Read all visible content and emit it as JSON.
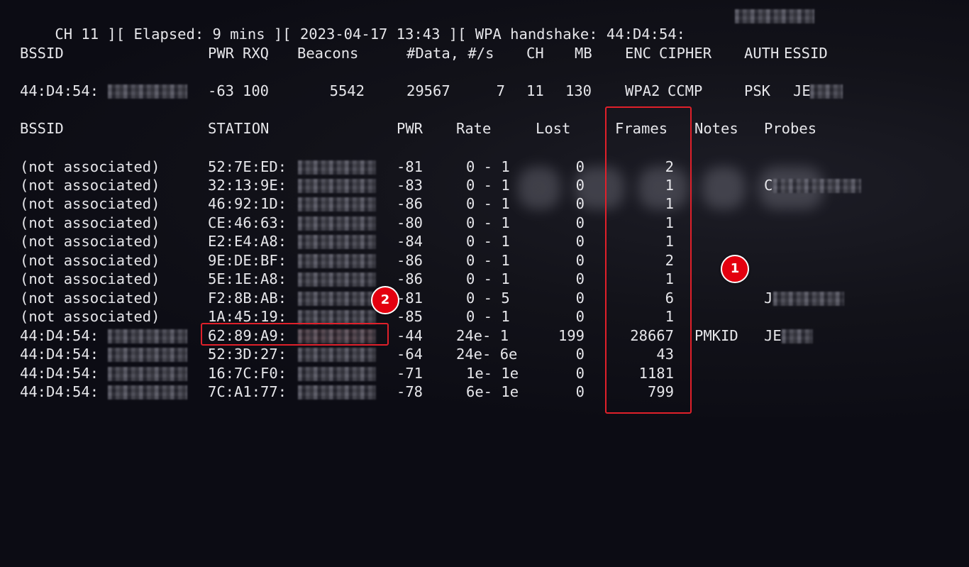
{
  "status_line": {
    "text": "CH 11 ][ Elapsed: 9 mins ][ 2023-04-17 13:43 ][ WPA handshake: 44:D4:54:"
  },
  "ap_table": {
    "headers": [
      "BSSID",
      "PWR",
      "RXQ",
      "Beacons",
      "#Data, #/s",
      "CH",
      "MB",
      "ENC",
      "CIPHER",
      "AUTH",
      "ESSID"
    ],
    "row": {
      "bssid": "44:D4:54:",
      "pwr": "-63",
      "rxq": "100",
      "beacons": "5542",
      "data": "29567",
      "per_sec": "7",
      "ch": "11",
      "mb": "130",
      "enc": "WPA2",
      "cipher": "CCMP",
      "auth": "PSK",
      "essid": "JE"
    }
  },
  "station_table": {
    "headers": [
      "BSSID",
      "STATION",
      "PWR",
      "Rate",
      "Lost",
      "Frames",
      "Notes",
      "Probes"
    ],
    "rows": [
      {
        "bssid": "(not associated)",
        "station": "52:7E:ED:",
        "pwr": "-81",
        "rate": "0 - 1",
        "lost": "0",
        "frames": "2",
        "notes": "",
        "probes": ""
      },
      {
        "bssid": "(not associated)",
        "station": "32:13:9E:",
        "pwr": "-83",
        "rate": "0 - 1",
        "lost": "0",
        "frames": "1",
        "notes": "",
        "probes": "C"
      },
      {
        "bssid": "(not associated)",
        "station": "46:92:1D:",
        "pwr": "-86",
        "rate": "0 - 1",
        "lost": "0",
        "frames": "1",
        "notes": "",
        "probes": ""
      },
      {
        "bssid": "(not associated)",
        "station": "CE:46:63:",
        "pwr": "-80",
        "rate": "0 - 1",
        "lost": "0",
        "frames": "1",
        "notes": "",
        "probes": ""
      },
      {
        "bssid": "(not associated)",
        "station": "E2:E4:A8:",
        "pwr": "-84",
        "rate": "0 - 1",
        "lost": "0",
        "frames": "1",
        "notes": "",
        "probes": ""
      },
      {
        "bssid": "(not associated)",
        "station": "9E:DE:BF:",
        "pwr": "-86",
        "rate": "0 - 1",
        "lost": "0",
        "frames": "2",
        "notes": "",
        "probes": ""
      },
      {
        "bssid": "(not associated)",
        "station": "5E:1E:A8:",
        "pwr": "-86",
        "rate": "0 - 1",
        "lost": "0",
        "frames": "1",
        "notes": "",
        "probes": ""
      },
      {
        "bssid": "(not associated)",
        "station": "F2:8B:AB:",
        "pwr": "-81",
        "rate": "0 - 5",
        "lost": "0",
        "frames": "6",
        "notes": "",
        "probes": "J"
      },
      {
        "bssid": "(not associated)",
        "station": "1A:45:19:",
        "pwr": "-85",
        "rate": "0 - 1",
        "lost": "0",
        "frames": "1",
        "notes": "",
        "probes": ""
      },
      {
        "bssid": "44:D4:54:",
        "station": "62:89:A9:",
        "pwr": "-44",
        "rate": "24e- 1",
        "lost": "199",
        "frames": "28667",
        "notes": "PMKID",
        "probes": "JE"
      },
      {
        "bssid": "44:D4:54:",
        "station": "52:3D:27:",
        "pwr": "-64",
        "rate": "24e- 6e",
        "lost": "0",
        "frames": "43",
        "notes": "",
        "probes": ""
      },
      {
        "bssid": "44:D4:54:",
        "station": "16:7C:F0:",
        "pwr": "-71",
        "rate": "1e- 1e",
        "lost": "0",
        "frames": "1181",
        "notes": "",
        "probes": ""
      },
      {
        "bssid": "44:D4:54:",
        "station": "7C:A1:77:",
        "pwr": "-78",
        "rate": "6e- 1e",
        "lost": "0",
        "frames": "799",
        "notes": "",
        "probes": ""
      }
    ]
  },
  "annotations": {
    "marker_1": "1",
    "marker_2": "2",
    "highlight_color": "#e0202a"
  }
}
